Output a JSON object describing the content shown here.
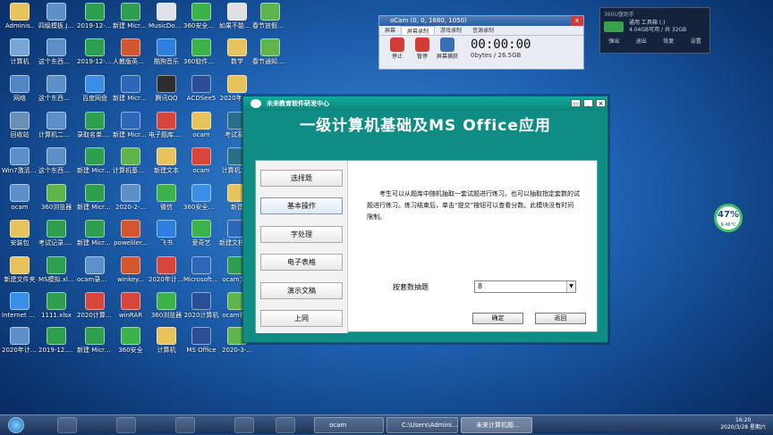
{
  "desktop_icons": [
    {
      "label": "Adminis..",
      "c": "#e8c25a"
    },
    {
      "label": "四级模板.JPG",
      "c": "#5d8fc9"
    },
    {
      "label": "2019-12-18 级记录.xlsx",
      "c": "#2e9e4f"
    },
    {
      "label": "新建 Microsoft...",
      "c": "#2e9e4f"
    },
    {
      "label": "MusicDow...",
      "c": "#dfe2e8"
    },
    {
      "label": "360安全卫士",
      "c": "#3bb34a"
    },
    {
      "label": "如果不能打开",
      "c": "#e0e0e0"
    },
    {
      "label": "春节放假通知.mp3",
      "c": "#5fb54c"
    },
    {
      "label": "计算机",
      "c": "#7aa6d6"
    },
    {
      "label": "这个东西很重要.JPG",
      "c": "#5d8fc9"
    },
    {
      "label": "2019-12-20 级记录.xlsx",
      "c": "#2e9e4f"
    },
    {
      "label": "人教版英文七上.pptx",
      "c": "#d2572e"
    },
    {
      "label": "酷狗音乐",
      "c": "#2f7fe0"
    },
    {
      "label": "360软件管家",
      "c": "#3bb34a"
    },
    {
      "label": "数学",
      "c": "#e8c25a"
    },
    {
      "label": "春节通知.mp3",
      "c": "#5fb54c"
    },
    {
      "label": "网络",
      "c": "#4f86c6"
    },
    {
      "label": "这个东西很重要2.jpg",
      "c": "#5d8fc9"
    },
    {
      "label": "百度网盘",
      "c": "#3a8ee6"
    },
    {
      "label": "新建 Microsoft...",
      "c": "#2e66b8"
    },
    {
      "label": "腾讯QQ",
      "c": "#2d2d2d"
    },
    {
      "label": "ACDSee5",
      "c": "#2a4f96"
    },
    {
      "label": "2020年度...",
      "c": "#e8c25a"
    },
    {
      "label": "回收站",
      "c": "#6c8fb8"
    },
    {
      "label": "计算机二级.png",
      "c": "#5d8fc9"
    },
    {
      "label": "录取名单.xlsx",
      "c": "#2e9e4f"
    },
    {
      "label": "新建 Microsoft...",
      "c": "#2e66b8"
    },
    {
      "label": "电子题库.pdf",
      "c": "#d8453a"
    },
    {
      "label": "ocam",
      "c": "#e8c25a"
    },
    {
      "label": "考试系统",
      "c": "#2a6f8a"
    },
    {
      "label": "Win7激活工具",
      "c": "#5d8fc9"
    },
    {
      "label": "这个东西很重要3.jpg",
      "c": "#5d8fc9"
    },
    {
      "label": "新建 Microsoft...",
      "c": "#2e9e4f"
    },
    {
      "label": "计算机基础.pptx",
      "c": "#5fb54c"
    },
    {
      "label": "新建文本",
      "c": "#e8c25a"
    },
    {
      "label": "ocam",
      "c": "#d8453a"
    },
    {
      "label": "计算机二级",
      "c": "#2a6f8a"
    },
    {
      "label": "ocam",
      "c": "#5d8fc9"
    },
    {
      "label": "360浏览器",
      "c": "#5fb54c"
    },
    {
      "label": "新建 Microsoft...",
      "c": "#2e9e4f"
    },
    {
      "label": "2020-2-...",
      "c": "#5d8fc9"
    },
    {
      "label": "微信",
      "c": "#3bb34a"
    },
    {
      "label": "360安全浏览器",
      "c": "#3a8ee6"
    },
    {
      "label": "新建",
      "c": "#e8c25a"
    },
    {
      "label": "安装包",
      "c": "#e8c25a"
    },
    {
      "label": "考试记录.xlsx",
      "c": "#2e9e4f"
    },
    {
      "label": "新建 Microsoft...",
      "c": "#2e9e4f"
    },
    {
      "label": "poweliler...",
      "c": "#d2572e"
    },
    {
      "label": "飞书",
      "c": "#2f7fe0"
    },
    {
      "label": "爱奇艺",
      "c": "#3bb34a"
    },
    {
      "label": "新建文档.docx",
      "c": "#2e66b8"
    },
    {
      "label": "新建文件夹",
      "c": "#e8c25a"
    },
    {
      "label": "MS模拟.xlsx",
      "c": "#2e9e4f"
    },
    {
      "label": "ocam录制.mp4",
      "c": "#5d8fc9"
    },
    {
      "label": "winkey...",
      "c": "#d2572e"
    },
    {
      "label": "2020年计算机.zip",
      "c": "#d8453a"
    },
    {
      "label": "Microsoft Word",
      "c": "#2e66b8"
    },
    {
      "label": "ocam文件",
      "c": "#2e9e4f"
    },
    {
      "label": "Internet Explorer",
      "c": "#3a8ee6"
    },
    {
      "label": "1111.xlsx",
      "c": "#2e9e4f"
    },
    {
      "label": "2020计算机.xlsx",
      "c": "#d8453a"
    },
    {
      "label": "winRAR",
      "c": "#d8453a"
    },
    {
      "label": "360浏览器",
      "c": "#3bb34a"
    },
    {
      "label": "2020计算机",
      "c": "#2a4f96"
    },
    {
      "label": "ocam视频",
      "c": "#5fb54c"
    },
    {
      "label": "2020年计算机",
      "c": "#5d8fc9"
    },
    {
      "label": "2019-12...xlsx",
      "c": "#2e9e4f"
    },
    {
      "label": "新建 Microsoft...",
      "c": "#2e9e4f"
    },
    {
      "label": "360安全",
      "c": "#3bb34a"
    },
    {
      "label": "计算机",
      "c": "#e8c25a"
    },
    {
      "label": "MS Office",
      "c": "#2a4f96"
    },
    {
      "label": "2020-3-...",
      "c": "#5fb54c"
    }
  ],
  "ocam": {
    "title": "oCam (0, 0, 1680, 1050)",
    "close": "x",
    "tabs": [
      "屏幕",
      "屏幕录制",
      "游戏录制",
      "音源录制"
    ],
    "buttons": [
      "停止",
      "暂停",
      "屏幕捕获"
    ],
    "time": "00:00:00",
    "size": "0bytes / 26.5GB"
  },
  "widget360": {
    "header": "360U盘助手",
    "line1": "通用 工具箱 (:)",
    "line2": "4.04GB可用 / 共 32GB",
    "actions": [
      "弹出",
      "退出",
      "恢复",
      "设置"
    ]
  },
  "gauge": {
    "percent": "47%",
    "caption": "9.46°C"
  },
  "window": {
    "title": "未来教育软件研发中心",
    "heading": "一级计算机基础及MS Office应用",
    "nav": [
      "选择题",
      "基本操作",
      "字处理",
      "电子表格",
      "演示文稿",
      "上网"
    ],
    "active_nav": 1,
    "description": "考生可以从题库中随机抽取一套试题进行练习。也可以抽取指定套数的试题进行练习。练习结束后，单击“提交”按钮可以查看分数。此模块没有时间限制。",
    "set_label": "按套数抽题",
    "set_value": "8",
    "ok": "确定",
    "back": "返回"
  },
  "taskbar": {
    "items": [
      "ocam",
      "C:\\Users\\Admini...",
      "未来计算机题..."
    ],
    "time": "16:20",
    "date": "2020/3/28 星期六"
  }
}
